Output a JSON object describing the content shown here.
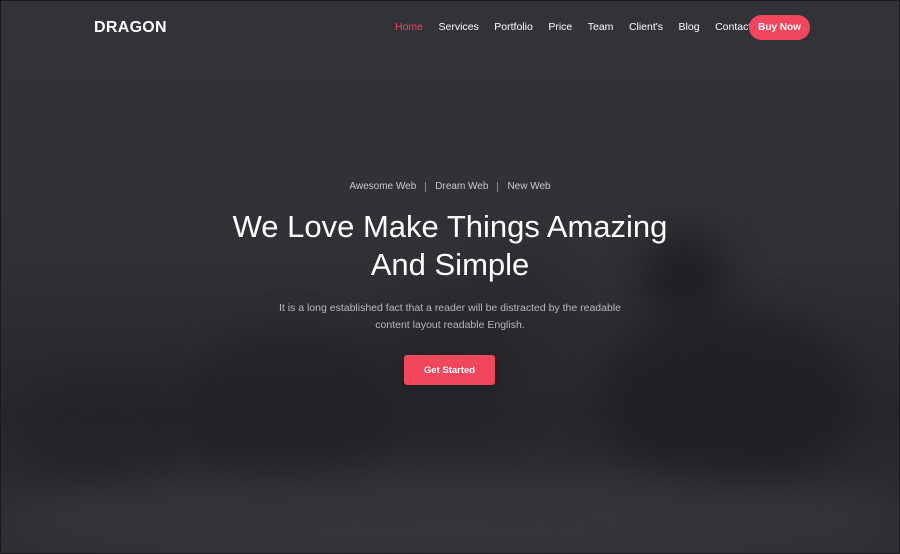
{
  "header": {
    "logo": "DRAGON",
    "nav": [
      {
        "label": "Home",
        "active": true
      },
      {
        "label": "Services"
      },
      {
        "label": "Portfolio"
      },
      {
        "label": "Price"
      },
      {
        "label": "Team"
      },
      {
        "label": "Client's"
      },
      {
        "label": "Blog"
      },
      {
        "label": "Contact"
      }
    ],
    "buy_button": "Buy Now"
  },
  "hero": {
    "tags": [
      "Awesome Web",
      "Dream Web",
      "New Web"
    ],
    "headline_line1": "We Love Make Things Amazing",
    "headline_line2": "And Simple",
    "subtext_line1": "It is a long established fact that a reader will be distracted by the readable",
    "subtext_line2": "content layout readable English.",
    "cta_label": "Get Started"
  },
  "colors": {
    "accent": "#f2465c",
    "background": "#2b2c30",
    "text": "#ffffff"
  }
}
